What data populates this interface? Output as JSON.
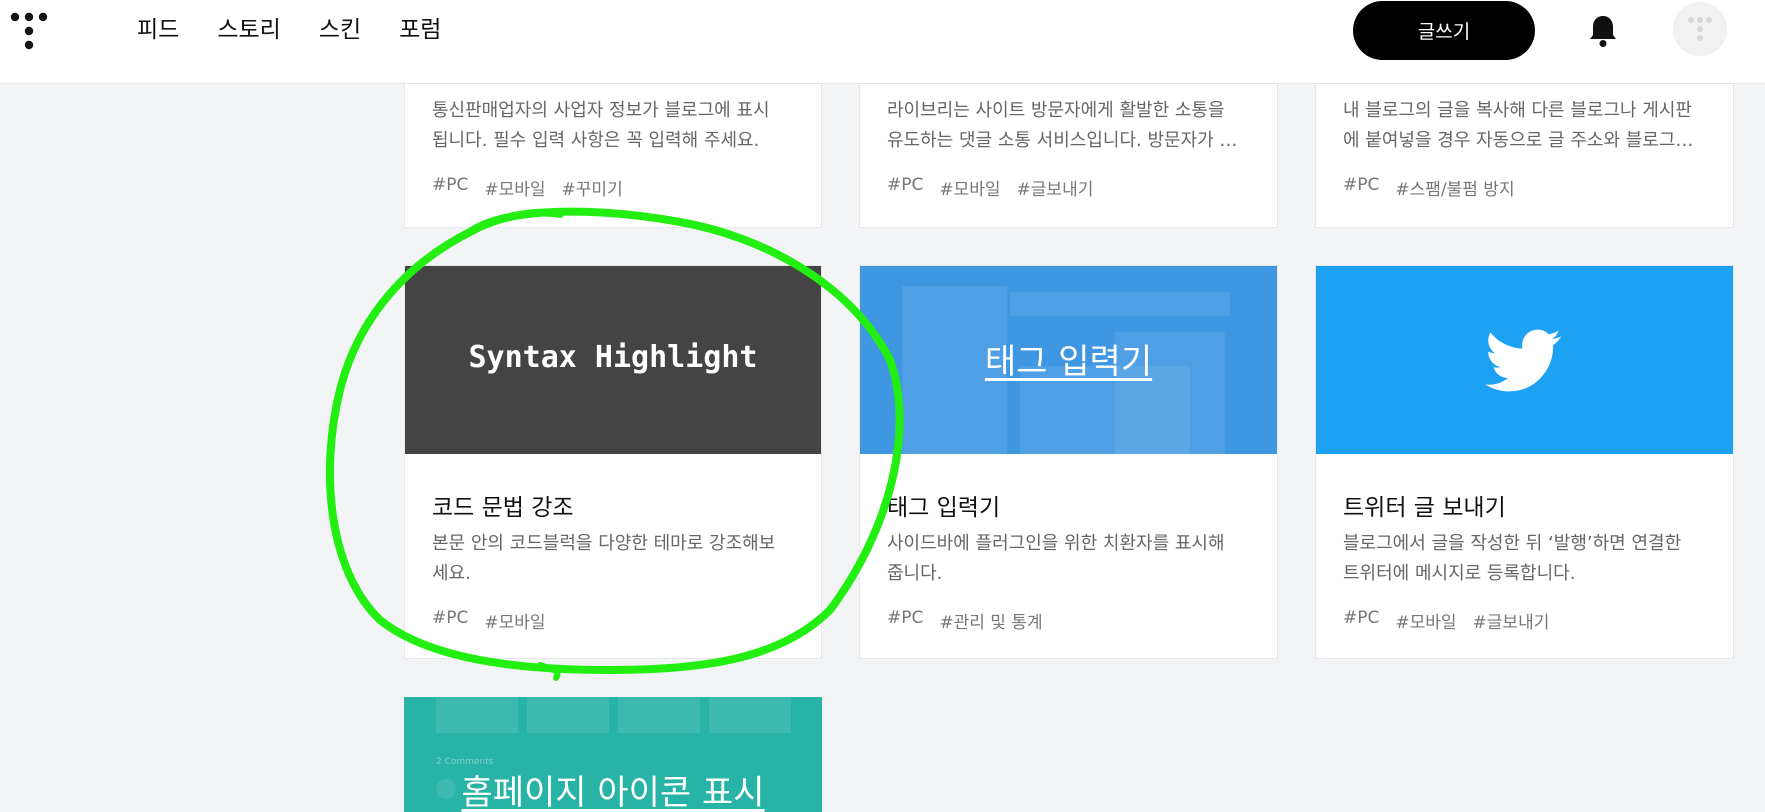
{
  "header": {
    "nav": [
      "피드",
      "스토리",
      "스킨",
      "포럼"
    ],
    "write_label": "글쓰기"
  },
  "cards": {
    "row1": [
      {
        "desc_lines": [
          "통신판매업자의 사업자 정보가 블로그에 표시",
          "됩니다. 필수 입력 사항은 꼭 입력해 주세요."
        ],
        "tags": [
          "#PC",
          "#모바일",
          "#꾸미기"
        ]
      },
      {
        "desc_lines": [
          "라이브리는 사이트 방문자에게 활발한 소통을",
          "유도하는 댓글 소통 서비스입니다. 방문자가 …"
        ],
        "tags": [
          "#PC",
          "#모바일",
          "#글보내기"
        ]
      },
      {
        "desc_lines": [
          "내 블로그의 글을 복사해 다른 블로그나 게시판",
          "에 붙여넣을 경우 자동으로 글 주소와 블로그…"
        ],
        "tags": [
          "#PC",
          "#스팸/불펌 방지"
        ]
      }
    ],
    "row2": [
      {
        "thumb_text": "Syntax Highlight",
        "title": "코드 문법 강조",
        "desc_lines": [
          "본문 안의 코드블럭을 다양한 테마로 강조해보",
          "세요."
        ],
        "tags": [
          "#PC",
          "#모바일"
        ]
      },
      {
        "thumb_text": "태그 입력기",
        "title": "태그 입력기",
        "desc_lines": [
          "사이드바에 플러그인을 위한 치환자를 표시해",
          "줍니다."
        ],
        "tags": [
          "#PC",
          "#관리 및 통계"
        ]
      },
      {
        "title": "트위터 글 보내기",
        "desc_lines": [
          "블로그에서 글을 작성한 뒤 ‘발행’하면 연결한",
          "트위터에 메시지로 등록합니다."
        ],
        "tags": [
          "#PC",
          "#모바일",
          "#글보내기"
        ]
      }
    ],
    "row3": [
      {
        "thumb_text": "홈페이지 아이콘 표시",
        "thumb_sub": "2 Comments"
      }
    ]
  },
  "icons": {
    "logo": "tistory-logo-icon",
    "bell": "bell-icon",
    "avatar": "avatar-icon",
    "twitter": "twitter-bird-icon"
  },
  "colors": {
    "background": "#f3f4f6",
    "write_button": "#000000",
    "syntax_thumb": "#444444",
    "tag_thumb": "#3f97e1",
    "twitter_thumb": "#1da1f2",
    "home_thumb": "#27b3a5",
    "annotation": "#22ee11"
  }
}
